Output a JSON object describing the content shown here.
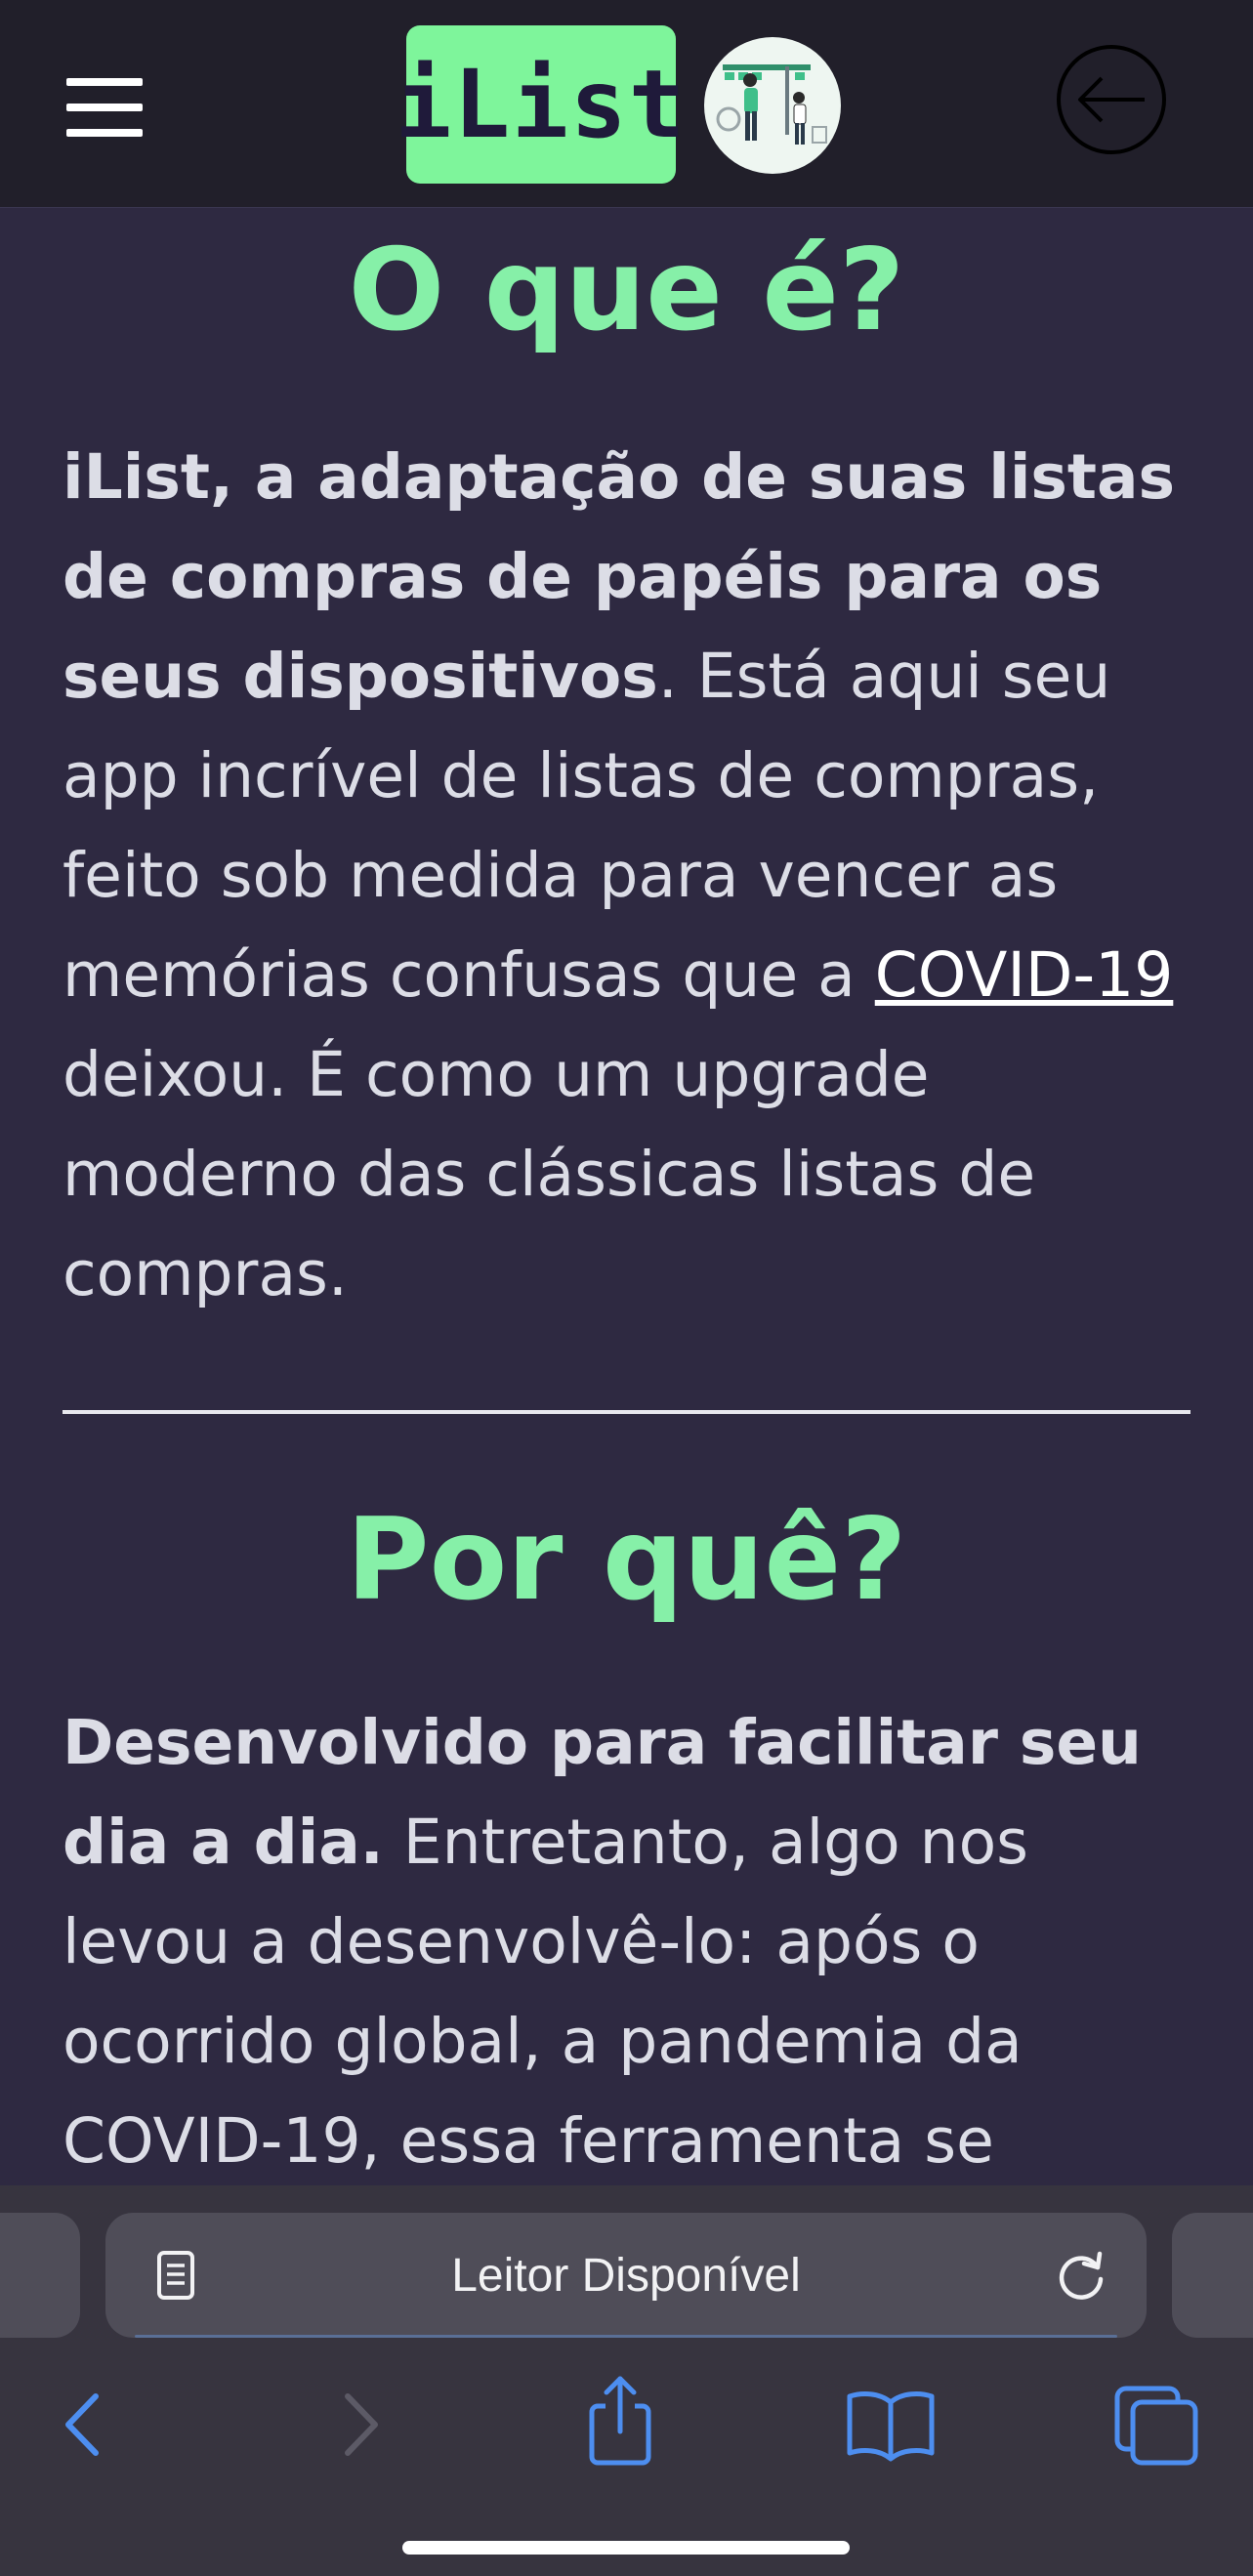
{
  "header": {
    "logo_text": "iList",
    "menu_icon": "hamburger-menu-icon",
    "logout_icon": "logout-arrow-icon",
    "illustration": "shopping-couple-illustration"
  },
  "colors": {
    "background": "#2e2941",
    "header_bg": "#211f2a",
    "accent_green": "#86f0a8",
    "logo_bg": "#7ef59b",
    "text": "#dcdde6",
    "browser_blue": "#4d8ef0"
  },
  "sections": {
    "what": {
      "title": "O que é?",
      "bold": "iList, a adaptação de suas listas de compras de papéis para os seus dispositivos",
      "text_before_link": ". Está aqui seu app incrível de listas de compras, feito sob medida para vencer as memórias confusas que a ",
      "link_text": "COVID-19",
      "text_after_link": " deixou. É como um upgrade moderno das clássicas listas de compras."
    },
    "why": {
      "title": "Por quê?",
      "bold": "Desenvolvido para facilitar seu dia a dia.",
      "text": " Entretanto, algo nos levou a desenvolvê-lo: após o ocorrido global, a pandemia da COVID-19, essa ferramenta se"
    }
  },
  "browser": {
    "url_bar_text": "Leitor Disponível",
    "reader_icon": "reader-mode-icon",
    "reload_icon": "reload-icon",
    "toolbar_icons": [
      "back-icon",
      "forward-icon",
      "share-icon",
      "bookmarks-icon",
      "tabs-icon"
    ]
  }
}
